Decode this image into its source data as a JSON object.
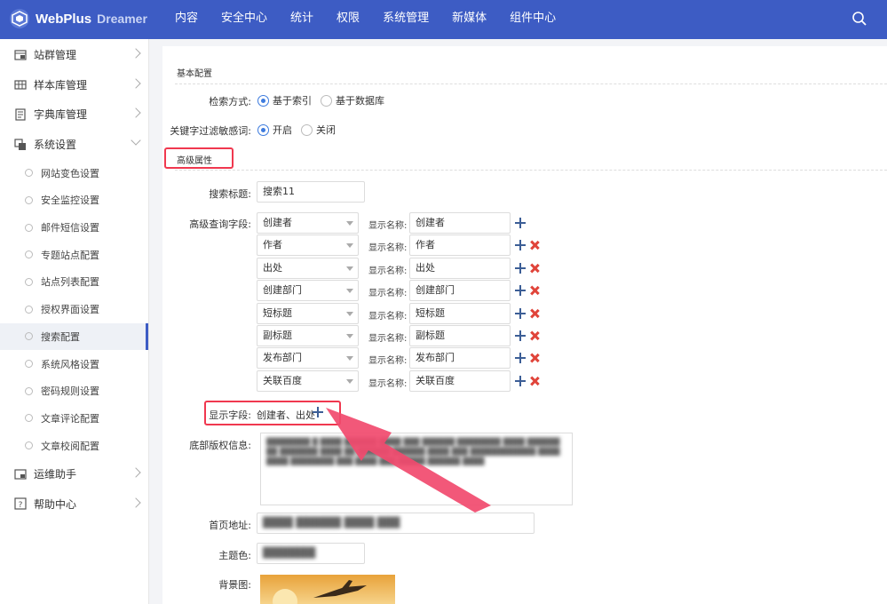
{
  "brand": {
    "name": "WebPlus",
    "edition": "Dreamer"
  },
  "topnav": [
    "内容",
    "安全中心",
    "统计",
    "权限",
    "系统管理",
    "新媒体",
    "组件中心"
  ],
  "sidebar": {
    "menu": [
      {
        "label": "站群管理",
        "icon": "sites-icon"
      },
      {
        "label": "样本库管理",
        "icon": "library-icon"
      },
      {
        "label": "字典库管理",
        "icon": "dictionary-icon"
      },
      {
        "label": "系统设置",
        "icon": "settings-icon",
        "expanded": true
      }
    ],
    "submenu": [
      "网站变色设置",
      "安全监控设置",
      "邮件短信设置",
      "专题站点配置",
      "站点列表配置",
      "授权界面设置",
      "搜索配置",
      "系统风格设置",
      "密码规则设置",
      "文章评论配置",
      "文章校阅配置"
    ],
    "active_submenu": "搜索配置",
    "menu_after": [
      {
        "label": "运维助手",
        "icon": "ops-icon"
      },
      {
        "label": "帮助中心",
        "icon": "help-icon"
      }
    ]
  },
  "form": {
    "basic_title": "基本配置",
    "search_mode": {
      "label": "检索方式:",
      "options": [
        "基于索引",
        "基于数据库"
      ],
      "selected": 0
    },
    "keyword_filter": {
      "label": "关键字过滤敏感词:",
      "options": [
        "开启",
        "关闭"
      ],
      "selected": 0
    },
    "advanced_title": "高级属性",
    "search_title": {
      "label": "搜索标题:",
      "value": "搜索11"
    },
    "query_fields_label": "高级查询字段:",
    "display_name_label": "显示名称:",
    "query_fields": [
      {
        "field": "创建者",
        "display": "创建者"
      },
      {
        "field": "作者",
        "display": "作者"
      },
      {
        "field": "出处",
        "display": "出处"
      },
      {
        "field": "创建部门",
        "display": "创建部门"
      },
      {
        "field": "短标题",
        "display": "短标题"
      },
      {
        "field": "副标题",
        "display": "副标题"
      },
      {
        "field": "发布部门",
        "display": "发布部门"
      },
      {
        "field": "关联百度",
        "display": "关联百度"
      }
    ],
    "show_fields": {
      "label": "显示字段:",
      "value": "创建者、出处"
    },
    "copyright": {
      "label": "底部版权信息:"
    },
    "homepage": {
      "label": "首页地址:"
    },
    "theme_color": {
      "label": "主题色:"
    },
    "background": {
      "label": "背景图:"
    }
  },
  "colors": {
    "topbar": "#3d5cc4",
    "accent": "#3d7bde",
    "highlight": "#f0384f",
    "plus": "#3c5e96",
    "remove": "#e0443a"
  }
}
